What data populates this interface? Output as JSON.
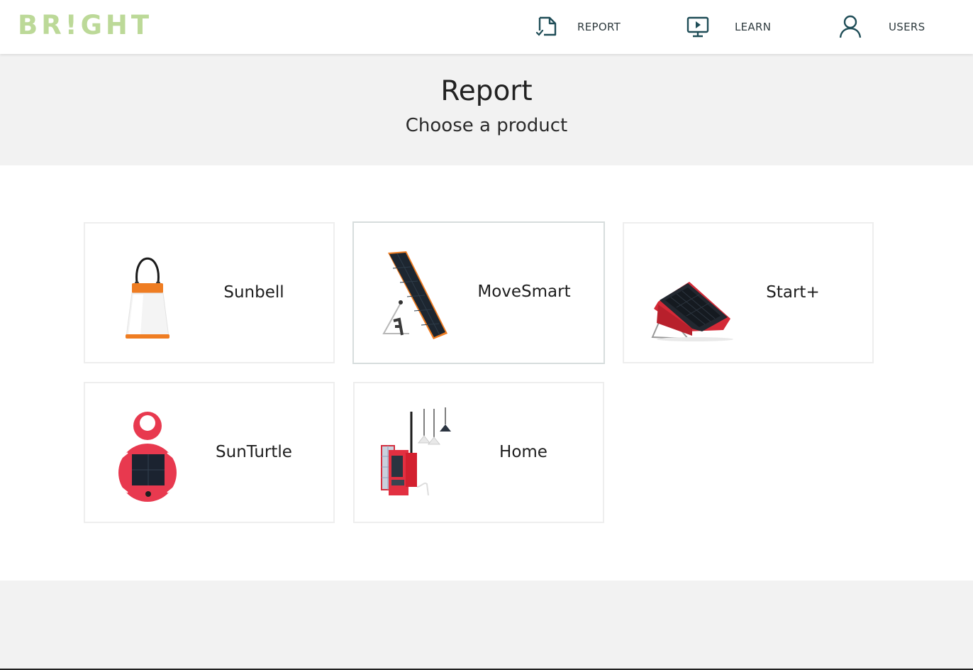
{
  "brand": {
    "logo_text": "BR!GHT",
    "logo_color": "#bcd998"
  },
  "nav": {
    "report_label": "REPORT",
    "learn_label": "LEARN",
    "users_label": "USERS"
  },
  "header": {
    "title": "Report",
    "subtitle": "Choose a product"
  },
  "products": [
    {
      "name": "Sunbell",
      "icon": "lantern-product-image"
    },
    {
      "name": "MoveSmart",
      "icon": "solar-panel-product-image",
      "selected": true
    },
    {
      "name": "Start+",
      "icon": "red-solar-panel-product-image"
    },
    {
      "name": "SunTurtle",
      "icon": "round-solar-light-product-image"
    },
    {
      "name": "Home",
      "icon": "home-solar-kit-product-image"
    }
  ]
}
